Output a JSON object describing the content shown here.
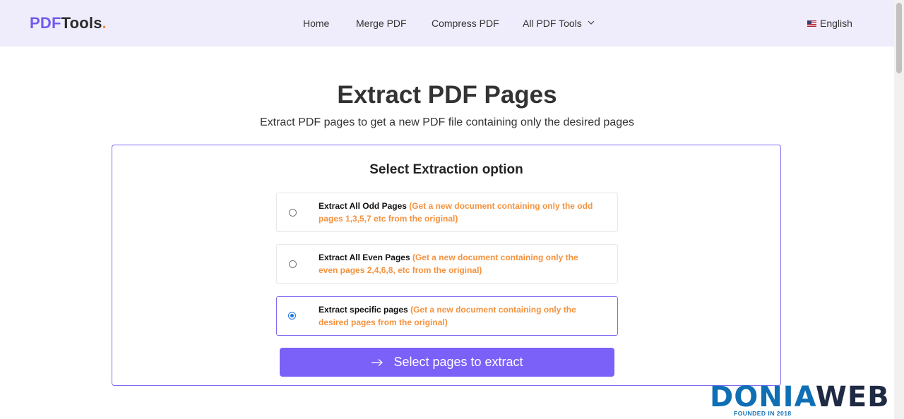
{
  "header": {
    "logo": {
      "part1": "PDF",
      "part2": "Tools",
      "dot": "."
    },
    "nav": [
      {
        "label": "Home"
      },
      {
        "label": "Merge PDF"
      },
      {
        "label": "Compress PDF"
      },
      {
        "label": "All PDF Tools"
      }
    ],
    "language": "English"
  },
  "main": {
    "title": "Extract PDF Pages",
    "subtitle": "Extract PDF pages to get a new PDF file containing only the desired pages",
    "panel": {
      "title": "Select Extraction option",
      "options": [
        {
          "label": "Extract All Odd Pages",
          "description": "(Get a new document containing only the odd pages 1,3,5,7 etc from the original)",
          "selected": false
        },
        {
          "label": "Extract All Even Pages",
          "description": "(Get a new document containing only the even pages 2,4,6,8, etc from the original)",
          "selected": false
        },
        {
          "label": "Extract specific pages",
          "description": "(Get a new document containing only the desired pages from the original)",
          "selected": true
        }
      ],
      "button_label": "Select pages to extract"
    }
  },
  "watermark": {
    "text_a": "DONIA",
    "text_b": "WEB",
    "tagline": "FOUNDED IN 2018"
  },
  "colors": {
    "accent": "#7b61f8",
    "header_bg": "#efedfb",
    "description": "#f5923e"
  }
}
